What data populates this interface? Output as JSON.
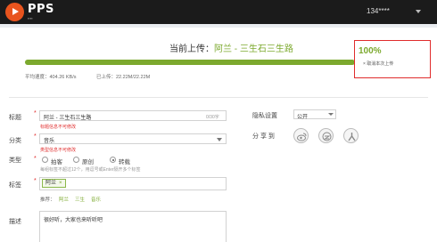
{
  "header": {
    "logo_text": "PPS",
    "account": "134****"
  },
  "upload": {
    "title_prefix": "当前上传：",
    "title_name": "阿兰 - 三生石三生路",
    "progress_percent_label": "100%",
    "progress_value": 1.0,
    "speed": "平均速度：404.26 KB/s",
    "uploaded": "已上传：22.22M/22.22M",
    "cancel": "× 取消本次上传",
    "accent_color": "#7ca92e",
    "highlight_border_color": "#e02c2c"
  },
  "form": {
    "title": {
      "label": "标题",
      "value": "阿兰 - 三生石三生路",
      "counter": "0/30字",
      "error": "标题信息不可修改"
    },
    "category": {
      "label": "分类",
      "value": "音乐",
      "error": "类型信息不可修改"
    },
    "type": {
      "label": "类型",
      "options": [
        "拍客",
        "原创",
        "转载"
      ],
      "selected": "转载",
      "hint": "每组标签不超过12个，用逗号或Enter隔开多个标签"
    },
    "tags": {
      "label": "标签",
      "chip": "阿兰",
      "chip_remove": "×",
      "recommend_label": "推荐：",
      "recommended": [
        "阿兰",
        "三生",
        "音乐"
      ]
    },
    "description": {
      "label": "描述",
      "value": "很好听，大家也来听听吧"
    }
  },
  "side": {
    "privacy": {
      "label": "隐私设置",
      "value": "公开"
    },
    "share": {
      "label": "分 享 到",
      "icons": [
        "weibo-icon",
        "qzone-icon",
        "renren-icon"
      ]
    }
  }
}
